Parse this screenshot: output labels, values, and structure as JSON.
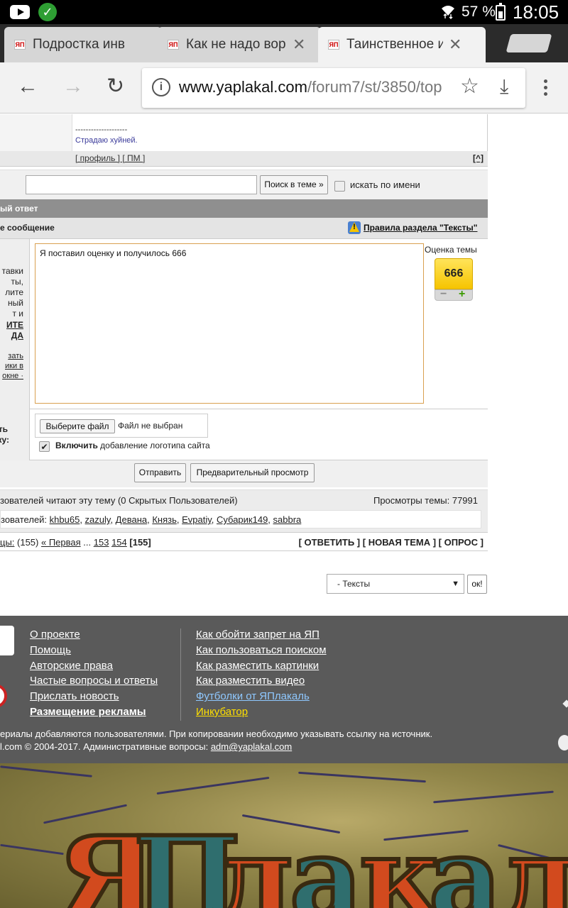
{
  "status": {
    "battery": "57 %",
    "time": "18:05"
  },
  "tabs": [
    {
      "title": "Подростка инв",
      "active": false,
      "closable": false
    },
    {
      "title": "Как не надо вор",
      "active": false,
      "closable": true
    },
    {
      "title": "Таинственное и",
      "active": true,
      "closable": true
    }
  ],
  "toolbar": {
    "url_host": "www.yaplakal.com",
    "url_path": "/forum7/st/3850/top"
  },
  "post": {
    "sig_separator": "--------------------",
    "sig_text": "Страдаю хуйней.",
    "footer_links": "[ профиль ] [ ПМ ]",
    "top_link": "[^]"
  },
  "search": {
    "button": "Поиск в теме »",
    "by_name_label": "искать по имени"
  },
  "reply": {
    "header": "ый ответ",
    "message_label": "е сообщение",
    "rules_link": "Правила раздела \"Тексты\"",
    "text": "Я поставил оценку и получилось 666",
    "left_hints": [
      "тавки",
      "ты,",
      "лите",
      "ный",
      "т и",
      "ИТЕ",
      "ДА",
      "зать",
      "ики в",
      "окне ·"
    ],
    "rating_label": "Оценка темы",
    "rating_value": "666",
    "rating_minus": "−",
    "rating_plus": "+"
  },
  "attach": {
    "left_label_1": "ть",
    "left_label_2": "ку:",
    "choose_button": "Выберите файл",
    "no_file": "Файл не выбран",
    "logo_bold": "Включить",
    "logo_rest": " добавление логотипа сайта",
    "checkmark": "✔"
  },
  "submit": {
    "send": "Отправить",
    "preview": "Предварительный просмотр"
  },
  "readers": {
    "line": "зователей читают эту тему (0 Скрытых Пользователей)",
    "views": "Просмотры темы: 77991",
    "users_prefix": "зователей: ",
    "users": [
      "khbu65",
      "zazuly",
      "Девана",
      "Князь",
      "Evpatiy",
      "Субарик149",
      "sabbra"
    ]
  },
  "pages": {
    "prefix": "цы:",
    "count": " (155) ",
    "first": "« Первая",
    "ellipsis": " ... ",
    "p1": "153",
    "p2": "154",
    "current": "[155]",
    "actions": "[ ОТВЕТИТЬ ] [ НОВАЯ ТЕМА ] [ ОПРОС ]"
  },
  "jump": {
    "selected": "- Тексты",
    "ok": "ок!"
  },
  "footer": {
    "col1": [
      "О проекте",
      "Помощь",
      "Авторские права",
      "Частые вопросы и ответы",
      "Прислать новость",
      "Размещение рекламы"
    ],
    "col2": [
      "Как обойти запрет на ЯП",
      "Как пользоваться поиском",
      "Как разместить картинки",
      "Как разместить видео",
      "Футболки от ЯПлакаль",
      "Инкубатор"
    ],
    "note1": "ериалы добавляются пользователями. При копировании необходимо указывать ссылку на источник.",
    "note2_prefix": "l.com © 2004-2017. Административные вопросы: ",
    "email": "adm@yaplakal.com"
  },
  "banner": {
    "letters": [
      "Я",
      "П",
      "л",
      "а",
      "к",
      "а",
      "л"
    ]
  }
}
